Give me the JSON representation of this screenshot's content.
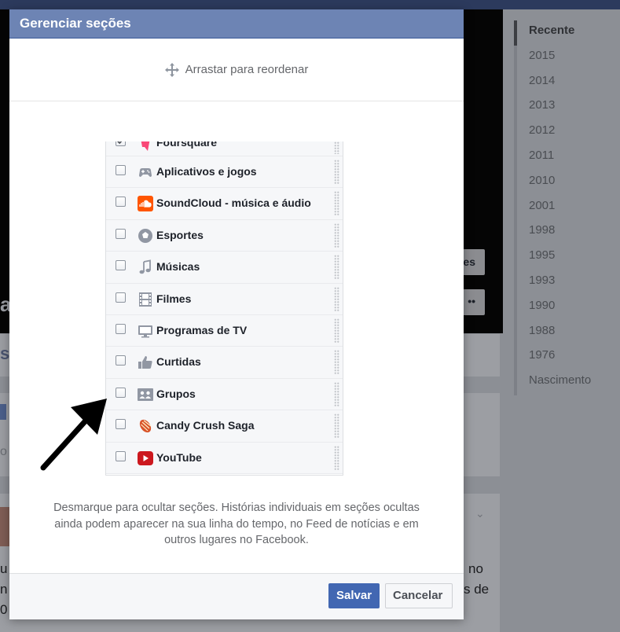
{
  "background": {
    "cover_btn1_text": "es",
    "cover_btn2_text": "••",
    "left_char": "a",
    "left_s": "s",
    "left_o": "o",
    "frag_right1": "no",
    "frag_right2": "s de",
    "frag_left1": "u",
    "frag_left2": "n",
    "frag_left3": "0"
  },
  "timeline": {
    "years": [
      "Recente",
      "2015",
      "2014",
      "2013",
      "2012",
      "2011",
      "2010",
      "2001",
      "1998",
      "1995",
      "1993",
      "1990",
      "1988",
      "1976",
      "Nascimento"
    ]
  },
  "modal": {
    "title": "Gerenciar seções",
    "drag_hint": "Arrastar para reordenar",
    "sections": [
      {
        "label": "Foursquare",
        "icon": "foursquare-icon",
        "checked": true
      },
      {
        "label": "Aplicativos e jogos",
        "icon": "gamepad-icon",
        "checked": false
      },
      {
        "label": "SoundCloud - música e áudio",
        "icon": "soundcloud-icon",
        "checked": false
      },
      {
        "label": "Esportes",
        "icon": "soccer-ball-icon",
        "checked": false
      },
      {
        "label": "Músicas",
        "icon": "music-note-icon",
        "checked": false
      },
      {
        "label": "Filmes",
        "icon": "film-icon",
        "checked": false
      },
      {
        "label": "Programas de TV",
        "icon": "tv-icon",
        "checked": false
      },
      {
        "label": "Curtidas",
        "icon": "thumbs-up-icon",
        "checked": false
      },
      {
        "label": "Grupos",
        "icon": "groups-icon",
        "checked": false
      },
      {
        "label": "Candy Crush Saga",
        "icon": "candy-icon",
        "checked": false
      },
      {
        "label": "YouTube",
        "icon": "youtube-icon",
        "checked": false
      }
    ],
    "description_lines": [
      "Desmarque para ocultar seções. Histórias individuais em seções ocultas",
      "ainda podem aparecer na sua linha do tempo, no Feed de notícias e em",
      "outros lugares no Facebook."
    ],
    "save_label": "Salvar",
    "cancel_label": "Cancelar"
  },
  "colors": {
    "header": "#6d84b4",
    "primary_button": "#4267b2",
    "overlay": "#8c8f95"
  }
}
